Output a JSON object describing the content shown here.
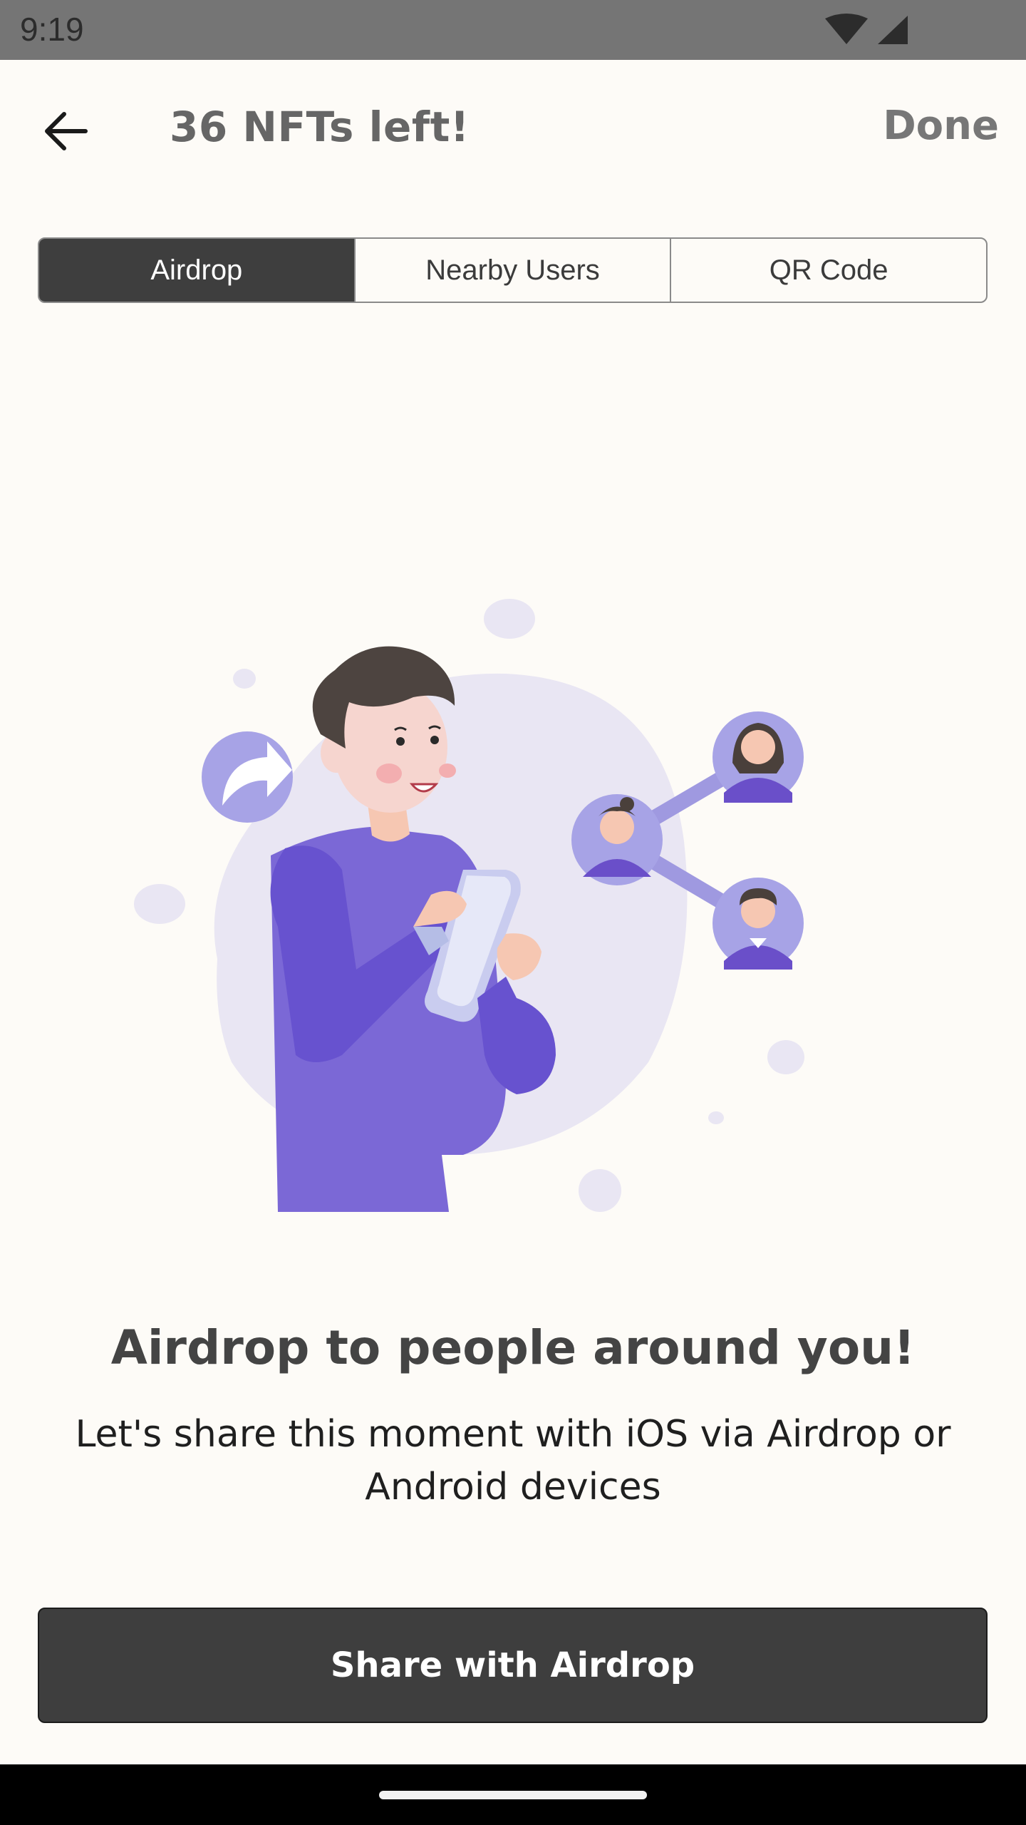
{
  "status_bar": {
    "time": "9:19",
    "icons": [
      "wifi-icon",
      "cellular-signal-icon"
    ]
  },
  "app_bar": {
    "back_icon": "arrow-left-icon",
    "title": "36 NFTs left!",
    "done_label": "Done"
  },
  "tabs": [
    {
      "label": "Airdrop",
      "selected": true
    },
    {
      "label": "Nearby Users",
      "selected": false
    },
    {
      "label": "QR Code",
      "selected": false
    }
  ],
  "illustration": {
    "name": "person-sharing-illustration",
    "share_icon": "share-arrow-icon"
  },
  "content": {
    "headline": "Airdrop to people around you!",
    "description": "Let's share this moment with iOS via Airdrop or Android devices"
  },
  "actions": {
    "share_label": "Share with Airdrop"
  },
  "colors": {
    "background": "#fdfbf7",
    "dark": "#3e3e3e",
    "accent_purple": "#7b68d6",
    "soft_purple": "#e9e6f3"
  }
}
